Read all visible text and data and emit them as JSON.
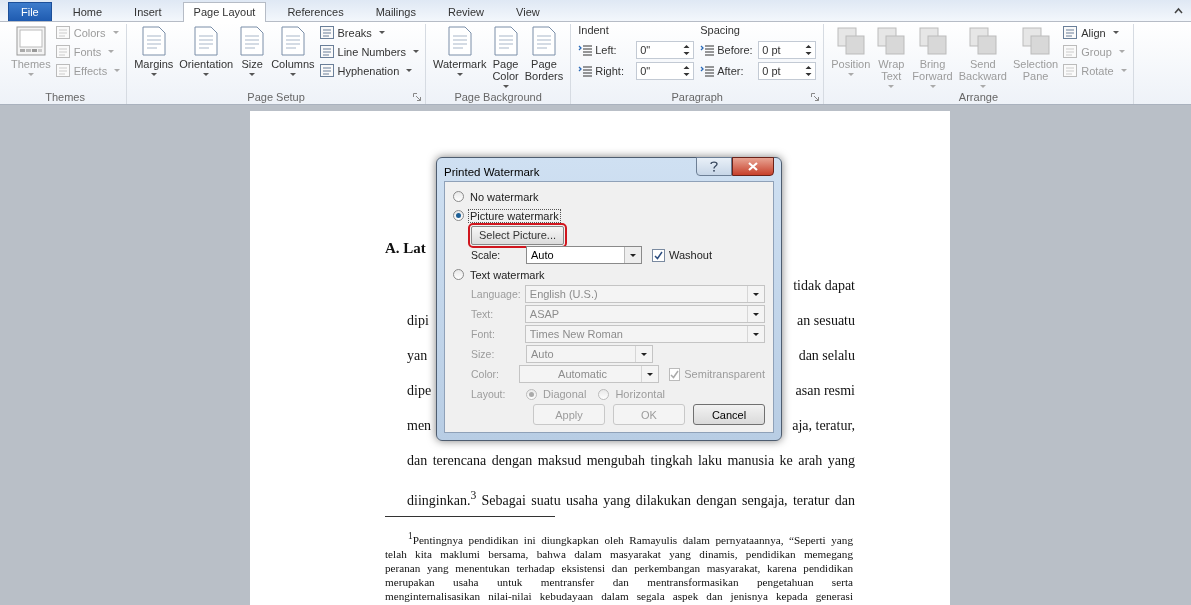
{
  "tabs": [
    {
      "label": "File",
      "kind": "file",
      "selected": false
    },
    {
      "label": "Home",
      "kind": "tab",
      "selected": false
    },
    {
      "label": "Insert",
      "kind": "tab",
      "selected": false
    },
    {
      "label": "Page Layout",
      "kind": "tab",
      "selected": true
    },
    {
      "label": "References",
      "kind": "tab",
      "selected": false
    },
    {
      "label": "Mailings",
      "kind": "tab",
      "selected": false
    },
    {
      "label": "Review",
      "kind": "tab",
      "selected": false
    },
    {
      "label": "View",
      "kind": "tab",
      "selected": false
    }
  ],
  "ribbon": {
    "groups": [
      {
        "label": "Themes",
        "launcher": false,
        "items": [
          {
            "kind": "large",
            "label": "Themes",
            "dropdown": true,
            "disabled": true
          },
          {
            "kind": "stack",
            "items": [
              {
                "label": "Colors",
                "dropdown": true,
                "disabled": true
              },
              {
                "label": "Fonts",
                "dropdown": true,
                "disabled": true
              },
              {
                "label": "Effects",
                "dropdown": true,
                "disabled": true
              }
            ]
          }
        ]
      },
      {
        "label": "Page Setup",
        "launcher": true,
        "items": [
          {
            "kind": "large",
            "label": "Margins",
            "dropdown": true,
            "disabled": false
          },
          {
            "kind": "large",
            "label": "Orientation",
            "dropdown": true,
            "disabled": false
          },
          {
            "kind": "large",
            "label": "Size",
            "dropdown": true,
            "disabled": false
          },
          {
            "kind": "large",
            "label": "Columns",
            "dropdown": true,
            "disabled": false
          },
          {
            "kind": "stack",
            "items": [
              {
                "label": "Breaks",
                "dropdown": true,
                "disabled": false
              },
              {
                "label": "Line Numbers",
                "dropdown": true,
                "disabled": false
              },
              {
                "label": "Hyphenation",
                "dropdown": true,
                "disabled": false
              }
            ]
          }
        ]
      },
      {
        "label": "Page Background",
        "launcher": false,
        "items": [
          {
            "kind": "large",
            "label": "Watermark",
            "dropdown": true,
            "disabled": false
          },
          {
            "kind": "large",
            "label": "Page Color",
            "dropdown": true,
            "disabled": false
          },
          {
            "kind": "large",
            "label": "Page Borders",
            "dropdown": false,
            "disabled": false
          }
        ]
      },
      {
        "label": "Paragraph",
        "launcher": true,
        "items": [
          {
            "kind": "spins",
            "heading": "Indent",
            "fields": [
              {
                "label": "Left:",
                "value": "0\""
              },
              {
                "label": "Right:",
                "value": "0\""
              }
            ]
          },
          {
            "kind": "spins",
            "heading": "Spacing",
            "fields": [
              {
                "label": "Before:",
                "value": "0 pt"
              },
              {
                "label": "After:",
                "value": "0 pt"
              }
            ]
          }
        ]
      },
      {
        "label": "Arrange",
        "launcher": false,
        "items": [
          {
            "kind": "large",
            "label": "Position",
            "dropdown": true,
            "disabled": true
          },
          {
            "kind": "large",
            "label": "Wrap Text",
            "dropdown": true,
            "disabled": true
          },
          {
            "kind": "large",
            "label": "Bring Forward",
            "dropdown": true,
            "disabled": true
          },
          {
            "kind": "large",
            "label": "Send Backward",
            "dropdown": true,
            "disabled": true
          },
          {
            "kind": "large",
            "label": "Selection Pane",
            "dropdown": false,
            "disabled": true
          },
          {
            "kind": "stack",
            "items": [
              {
                "label": "Align",
                "dropdown": true,
                "disabled": false
              },
              {
                "label": "Group",
                "dropdown": true,
                "disabled": true
              },
              {
                "label": "Rotate",
                "dropdown": true,
                "disabled": true
              }
            ]
          }
        ]
      }
    ]
  },
  "document": {
    "heading": "A. Lat",
    "split_lines": [
      {
        "right": "tidak dapat"
      },
      {
        "left": "dipi",
        "right": "an sesuatu"
      },
      {
        "left": "yan",
        "right": "dan selalu"
      },
      {
        "left": "dipe",
        "right": "asan resmi"
      },
      {
        "left": "men",
        "right": "aja, teratur,"
      }
    ],
    "lines": [
      "dan terencana dengan maksud mengubah tingkah laku manusia ke arah yang",
      "diinginkan.$^{3}$ Sebagai suatu usaha yang dilakukan dengan sengaja, teratur dan"
    ],
    "footnote": [
      "$^{1}$Pentingnya pendidikan ini diungkapkan oleh Ramayulis dalam pernyataannya, “Seperti yang",
      "telah kita maklumi bersama, bahwa dalam masyarakat yang dinamis, pendidikan memegang",
      "peranan yang menentukan terhadap eksistensi dan perkembangan masyarakat, karena pendidikan",
      "merupakan usaha untuk mentransfer dan mentransformasikan pengetahuan serta",
      "menginternalisasikan nilai-nilai kebudayaan dalam segala aspek dan jenisnya kepada generasi"
    ]
  },
  "dialog": {
    "title": "Printed Watermark",
    "options": [
      {
        "kind": "radio",
        "label": "No watermark",
        "selected": false,
        "focused": false
      },
      {
        "kind": "radio",
        "label": "Picture watermark",
        "selected": true,
        "focused": true
      },
      {
        "kind": "button",
        "label": "Select Picture...",
        "highlighted": true
      },
      {
        "kind": "combo",
        "label": "Scale:",
        "value": "Auto",
        "disabled": false,
        "check": {
          "label": "Washout",
          "checked": true,
          "disabled": false
        }
      },
      {
        "kind": "radio",
        "label": "Text watermark",
        "selected": false,
        "focused": false
      },
      {
        "kind": "combo",
        "label": "Language:",
        "value": "English (U.S.)",
        "disabled": true
      },
      {
        "kind": "combo",
        "label": "Text:",
        "value": "ASAP",
        "disabled": true
      },
      {
        "kind": "combo",
        "label": "Font:",
        "value": "Times New Roman",
        "disabled": true
      },
      {
        "kind": "combo",
        "label": "Size:",
        "value": "Auto",
        "disabled": true
      },
      {
        "kind": "combo",
        "label": "Color:",
        "value": "Automatic",
        "disabled": true,
        "check": {
          "label": "Semitransparent",
          "checked": true,
          "disabled": true
        }
      },
      {
        "kind": "layout",
        "label": "Layout:",
        "choices": [
          {
            "label": "Diagonal",
            "selected": true
          },
          {
            "label": "Horizontal",
            "selected": false
          }
        ]
      }
    ],
    "buttons": [
      {
        "label": "Apply",
        "disabled": true
      },
      {
        "label": "OK",
        "disabled": true
      },
      {
        "label": "Cancel",
        "disabled": false
      }
    ]
  }
}
